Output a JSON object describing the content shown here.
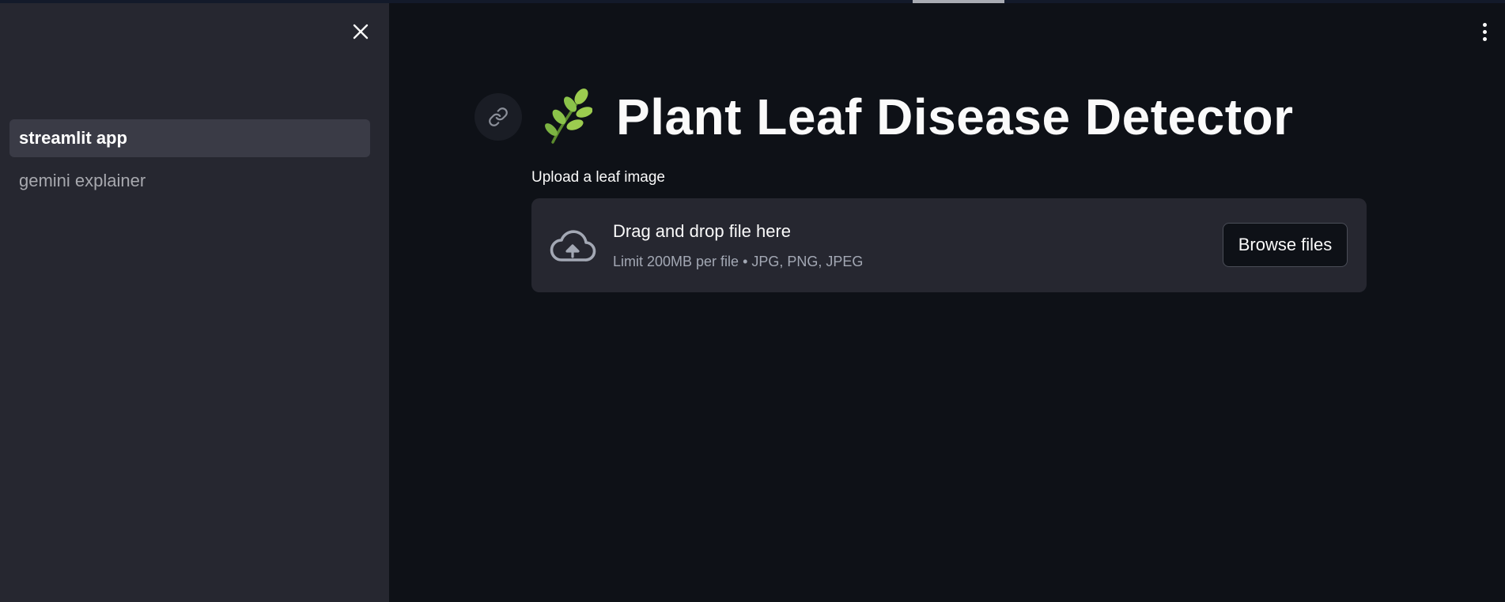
{
  "sidebar": {
    "close_icon": "close-icon",
    "items": [
      {
        "label": "streamlit app",
        "active": true
      },
      {
        "label": "gemini explainer",
        "active": false
      }
    ]
  },
  "header": {
    "menu_icon": "vertical-dots-icon"
  },
  "main": {
    "title_icon": "herb-leaf-icon",
    "anchor_icon": "link-icon",
    "title": "Plant Leaf Disease Detector",
    "uploader": {
      "label": "Upload a leaf image",
      "drop_title": "Drag and drop file here",
      "drop_limit": "Limit 200MB per file • JPG, PNG, JPEG",
      "browse_label": "Browse files",
      "icon": "cloud-upload-icon"
    }
  },
  "colors": {
    "background": "#0e1117",
    "sidebar": "#262730",
    "active_nav": "#3a3b46",
    "dropzone": "#262730",
    "leaf_green": "#8bc34a"
  }
}
